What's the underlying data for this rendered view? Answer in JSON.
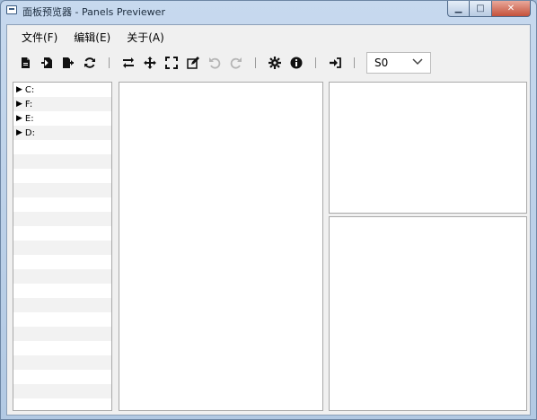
{
  "window": {
    "title": "面板预览器 - Panels Previewer"
  },
  "menu": [
    {
      "label": "文件(F)",
      "name": "menu-file"
    },
    {
      "label": "编辑(E)",
      "name": "menu-edit"
    },
    {
      "label": "关于(A)",
      "name": "menu-about"
    }
  ],
  "toolbar": {
    "icons": [
      "new-file-icon",
      "import-icon",
      "export-icon",
      "refresh-icon",
      "swap-icon",
      "move-icon",
      "fullscreen-icon",
      "edit-icon",
      "undo-icon",
      "redo-icon",
      "settings-icon",
      "info-icon",
      "exit-icon"
    ],
    "select_value": "S0"
  },
  "tree": {
    "items": [
      {
        "label": "C:"
      },
      {
        "label": "F:"
      },
      {
        "label": "E:"
      },
      {
        "label": "D:"
      }
    ]
  }
}
